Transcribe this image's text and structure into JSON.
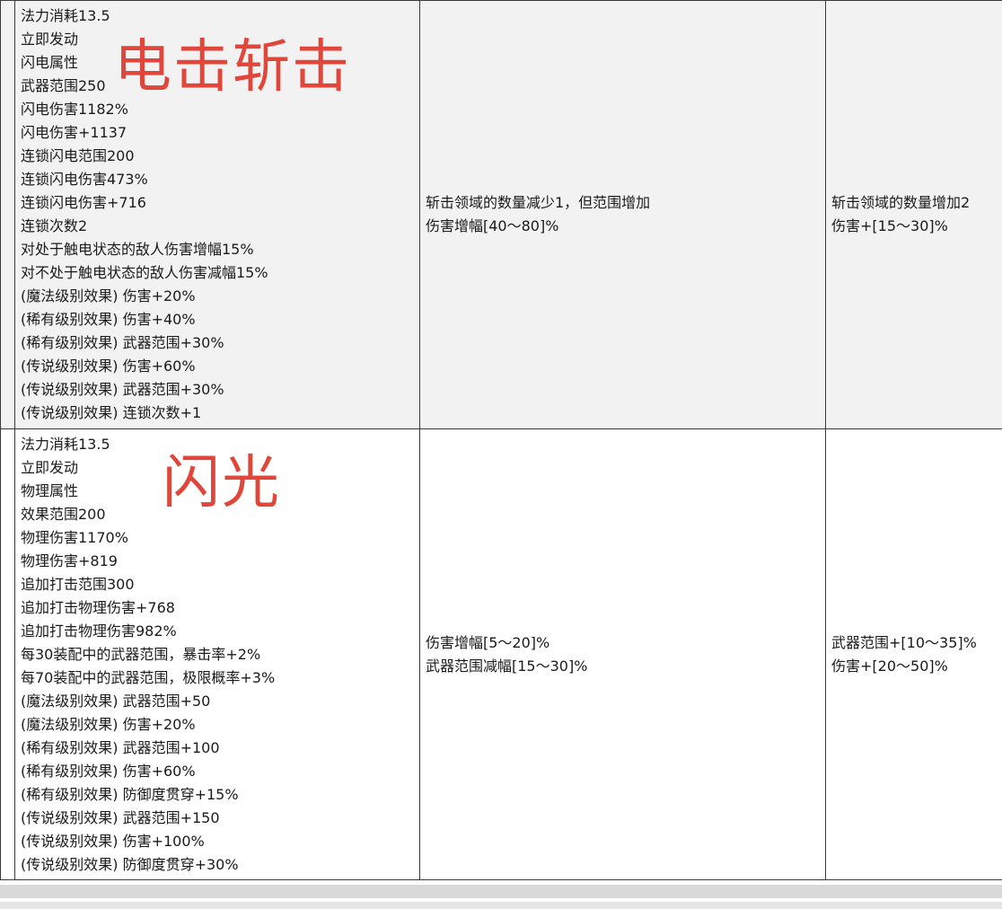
{
  "rows": [
    {
      "annotation": "电击斩击",
      "stats": [
        "法力消耗13.5",
        "立即发动",
        "闪电属性",
        "武器范围250",
        "闪电伤害1182%",
        "闪电伤害+1137",
        "连锁闪电范围200",
        "连锁闪电伤害473%",
        "连锁闪电伤害+716",
        "连锁次数2",
        "对处于触电状态的敌人伤害增幅15%",
        "对不处于触电状态的敌人伤害减幅15%",
        "(魔法级别效果) 伤害+20%",
        "(稀有级别效果) 伤害+40%",
        "(稀有级别效果) 武器范围+30%",
        "(传说级别效果) 伤害+60%",
        "(传说级别效果) 武器范围+30%",
        "(传说级别效果) 连锁次数+1"
      ],
      "effect_a": [
        "斩击领域的数量减少1，但范围增加",
        "伤害增幅[40～80]%"
      ],
      "effect_b": [
        "斩击领域的数量增加2",
        "伤害+[15～30]%"
      ]
    },
    {
      "annotation": "闪光",
      "stats": [
        "法力消耗13.5",
        "立即发动",
        "物理属性",
        "效果范围200",
        "物理伤害1170%",
        "物理伤害+819",
        "追加打击范围300",
        "追加打击物理伤害+768",
        "追加打击物理伤害982%",
        "每30装配中的武器范围，暴击率+2%",
        "每70装配中的武器范围，极限概率+3%",
        "(魔法级别效果) 武器范围+50",
        "(魔法级别效果) 伤害+20%",
        "(稀有级别效果) 武器范围+100",
        "(稀有级别效果) 伤害+60%",
        "(稀有级别效果) 防御度贯穿+15%",
        "(传说级别效果) 武器范围+150",
        "(传说级别效果) 伤害+100%",
        "(传说级别效果) 防御度贯穿+30%"
      ],
      "effect_a": [
        "伤害增幅[5～20]%",
        "武器范围减幅[15～30]%"
      ],
      "effect_b": [
        "武器范围+[10～35]%",
        "伤害+[20～50]%"
      ]
    }
  ],
  "colors": {
    "annotation": "#e0463a",
    "row_shaded": "#f2f2f2",
    "border": "#3a3a3a"
  }
}
